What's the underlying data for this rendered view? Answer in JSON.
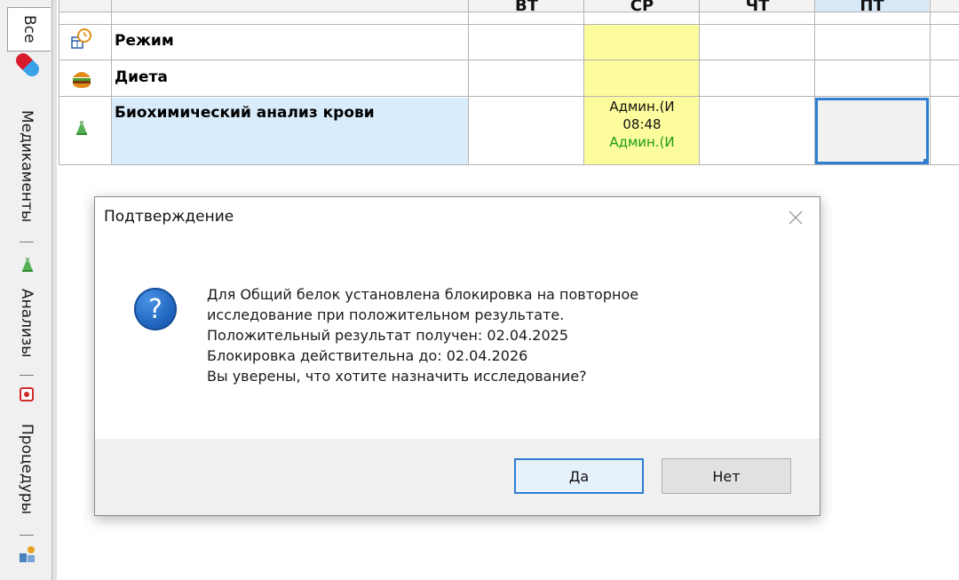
{
  "sidebar": {
    "tabs": [
      {
        "label": "Все",
        "active": true
      },
      {
        "label": "Медикаменты",
        "icon": "pill-icon"
      },
      {
        "label": "Анализы",
        "icon": "flask-icon"
      },
      {
        "label": "Процедуры",
        "icon": "procedure-icon"
      }
    ],
    "bottom_icon": "user-clock-icon"
  },
  "grid": {
    "day_headers": [
      "ВТ",
      "СР",
      "ЧТ",
      "ПТ"
    ],
    "rows": [
      {
        "icon": "schedule-clock-icon",
        "name": "Режим"
      },
      {
        "icon": "burger-icon",
        "name": "Диета"
      },
      {
        "icon": "flask-icon",
        "name": "Биохимический анализ крови"
      }
    ],
    "entry": {
      "line1": "Админ.(И",
      "line2": "08:48",
      "line3": "Админ.(И"
    },
    "colors": {
      "highlight_yellow": "#fdfc9c",
      "highlight_blue": "#d9ecfb",
      "selection": "#2d7ed1",
      "green_text": "#1a9a1a"
    }
  },
  "dialog": {
    "title": "Подтверждение",
    "icon": "question-icon",
    "message_lines": [
      "Для Общий белок установлена блокировка на повторное",
      "исследование при положительном результате.",
      "Положительный результат получен: 02.04.2025",
      "Блокировка действительна до: 02.04.2026",
      "Вы уверены, что хотите назначить исследование?"
    ],
    "buttons": {
      "yes": "Да",
      "no": "Нет"
    }
  }
}
